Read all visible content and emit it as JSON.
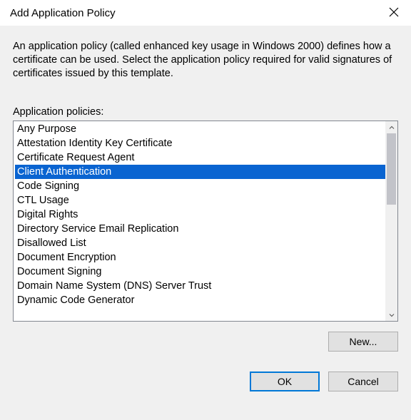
{
  "window": {
    "title": "Add Application Policy"
  },
  "description": "An application policy (called enhanced key usage in Windows 2000) defines how a certificate can be used. Select the application policy required for valid signatures of certificates issued by this template.",
  "listLabel": "Application policies:",
  "policies": {
    "selectedIndex": 3,
    "items": [
      "Any Purpose",
      "Attestation Identity Key Certificate",
      "Certificate Request Agent",
      "Client Authentication",
      "Code Signing",
      "CTL Usage",
      "Digital Rights",
      "Directory Service Email Replication",
      "Disallowed List",
      "Document Encryption",
      "Document Signing",
      "Domain Name System (DNS) Server Trust",
      "Dynamic Code Generator"
    ]
  },
  "buttons": {
    "new": "New...",
    "ok": "OK",
    "cancel": "Cancel"
  }
}
